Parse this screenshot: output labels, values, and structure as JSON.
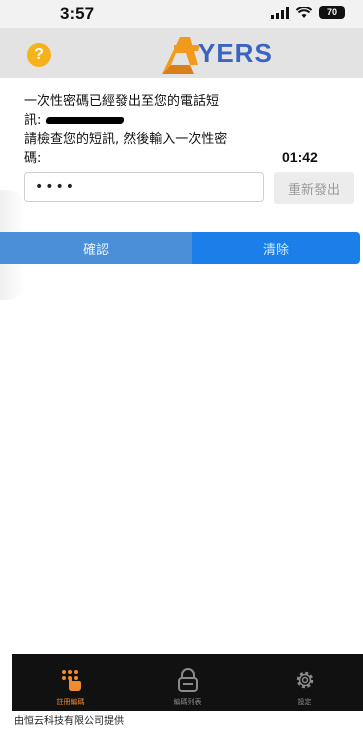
{
  "status_bar": {
    "time": "3:57",
    "battery": "70"
  },
  "header": {
    "help_icon": "?",
    "brand_mark": "A",
    "brand_text": "YERS"
  },
  "message": {
    "line1": "一次性密碼已經發出至您的電話短",
    "line2_prefix": "訊:",
    "line3": "請檢查您的短訊, 然後輸入一次性密",
    "line4": "碼:"
  },
  "countdown": "01:42",
  "otp": {
    "value": "••••"
  },
  "buttons": {
    "resend": "重新發出",
    "confirm": "確認",
    "clear": "清除"
  },
  "tabs": [
    {
      "label": "註冊編碼",
      "icon": "keypad-icon",
      "active": true
    },
    {
      "label": "編碼列表",
      "icon": "lock-icon",
      "active": false
    },
    {
      "label": "設定",
      "icon": "gear-icon",
      "active": false
    }
  ],
  "footer": {
    "provider": "由恒云科技有限公司提供"
  },
  "colors": {
    "accent": "#1a7fe8",
    "help": "#f5b21b",
    "brand_orange": "#f29a1e",
    "brand_blue": "#3b63c2",
    "tab_active": "#f28a2e"
  }
}
